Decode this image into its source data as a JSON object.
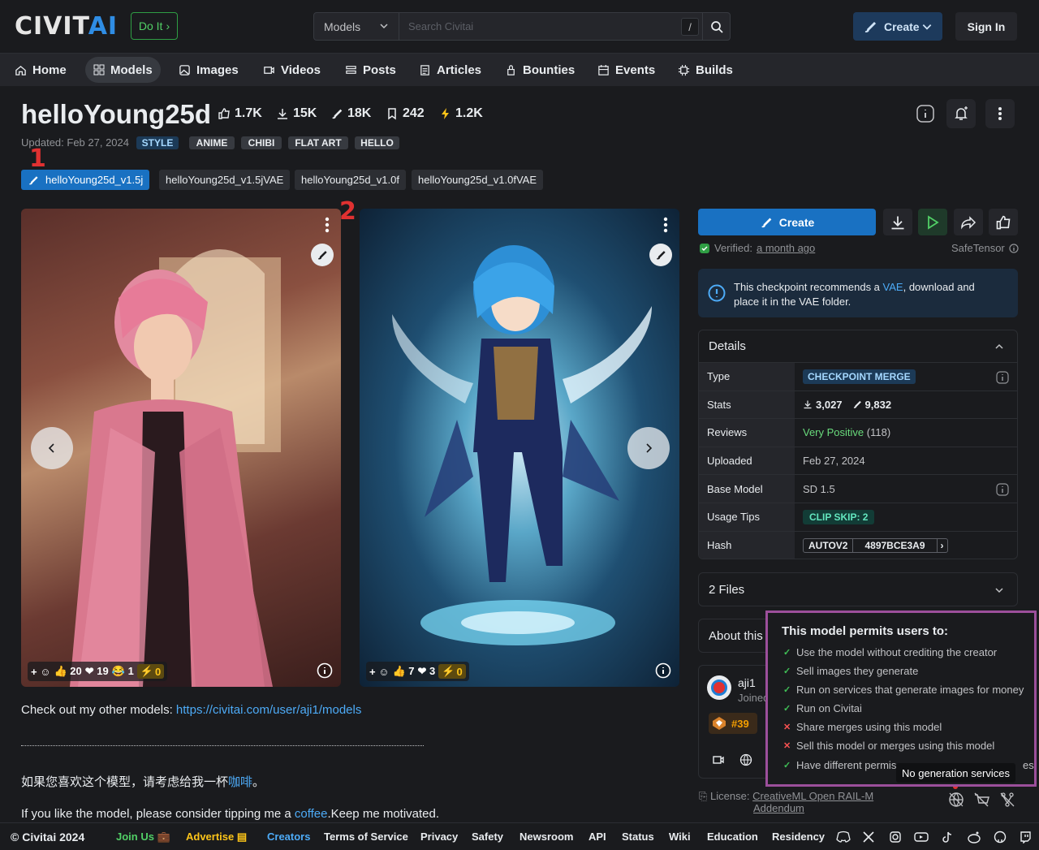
{
  "header": {
    "logo_main": "CIVIT",
    "logo_accent": "AI",
    "doit_label": "Do It",
    "search_type": "Models",
    "search_placeholder": "Search Civitai",
    "search_shortcut": "/",
    "create_label": "Create",
    "signin_label": "Sign In"
  },
  "nav": [
    {
      "label": "Home",
      "icon": "home-icon"
    },
    {
      "label": "Models",
      "icon": "models-icon"
    },
    {
      "label": "Images",
      "icon": "image-icon"
    },
    {
      "label": "Videos",
      "icon": "video-icon"
    },
    {
      "label": "Posts",
      "icon": "posts-icon"
    },
    {
      "label": "Articles",
      "icon": "article-icon"
    },
    {
      "label": "Bounties",
      "icon": "bounty-icon"
    },
    {
      "label": "Events",
      "icon": "calendar-icon"
    },
    {
      "label": "Builds",
      "icon": "cpu-icon"
    }
  ],
  "model": {
    "title": "helloYoung25d",
    "likes": "1.7K",
    "downloads": "15K",
    "generations": "18K",
    "collected": "242",
    "buzz": "1.2K",
    "updated": "Updated: Feb 27, 2024",
    "tags": [
      "STYLE",
      "ANIME",
      "CHIBI",
      "FLAT ART",
      "HELLO"
    ],
    "versions": [
      "helloYoung25d_v1.5j",
      "helloYoung25d_v1.5jVAE",
      "helloYoung25d_v1.0f",
      "helloYoung25d_v1.0fVAE"
    ],
    "annotation_1": "1",
    "annotation_2": "2"
  },
  "images": [
    {
      "likes": "20",
      "hearts": "19",
      "laughs": "1",
      "buzz": "0"
    },
    {
      "likes": "7",
      "hearts": "3",
      "buzz": "0"
    }
  ],
  "description": {
    "line1_text": "Check out my other models: ",
    "line1_link": "https://civitai.com/user/aji1/models",
    "line2_text": "如果您喜欢这个模型，请考虑给我一杯",
    "line2_link": "咖啡",
    "line2_end": "。",
    "line3_text": "If you like the model, please consider tipping me a ",
    "line3_link": "coffee",
    "line3_end": ".Keep me motivated."
  },
  "sidebar": {
    "create_label": "Create",
    "verified_label": "Verified:",
    "verified_time": "a month ago",
    "safetensor": "SafeTensor",
    "alert_pre": "This checkpoint recommends a ",
    "alert_link": "VAE",
    "alert_post": ", download and place it in the VAE folder.",
    "details_title": "Details",
    "type_key": "Type",
    "type_val": "CHECKPOINT MERGE",
    "stats_key": "Stats",
    "stats_downloads": "3,027",
    "stats_generations": "9,832",
    "reviews_key": "Reviews",
    "reviews_val": "Very Positive",
    "reviews_count": "(118)",
    "uploaded_key": "Uploaded",
    "uploaded_val": "Feb 27, 2024",
    "base_key": "Base Model",
    "base_val": "SD 1.5",
    "tips_key": "Usage Tips",
    "tips_val": "CLIP SKIP: 2",
    "hash_key": "Hash",
    "hash_type": "AUTOV2",
    "hash_val": "4897BCE3A9",
    "files_title": "2 Files",
    "about_title": "About this",
    "creator_name": "aji1",
    "creator_joined": "Joined",
    "creator_rank": "#39",
    "license_label": "License:",
    "license_link": "CreativeML Open RAIL-M",
    "license_link2": "Addendum"
  },
  "permissions": {
    "title": "This model permits users to:",
    "items": [
      {
        "text": "Use the model without crediting the creator",
        "allowed": true
      },
      {
        "text": "Sell images they generate",
        "allowed": true
      },
      {
        "text": "Run on services that generate images for money",
        "allowed": true
      },
      {
        "text": "Run on Civitai",
        "allowed": true
      },
      {
        "text": "Share merges using this model",
        "allowed": false
      },
      {
        "text": "Sell this model or merges using this model",
        "allowed": false
      },
      {
        "text": "Have different permis",
        "allowed": true
      }
    ],
    "tail": "es",
    "tooltip": "No generation services"
  },
  "footer": {
    "copyright": "© Civitai 2024",
    "links": [
      "Join Us",
      "Advertise",
      "Creators",
      "Terms of Service",
      "Privacy",
      "Safety",
      "Newsroom",
      "API",
      "Status",
      "Wiki",
      "Education",
      "Residency"
    ]
  },
  "colors": {
    "accent": "#1971c2",
    "success": "#40c057",
    "danger": "#fa5252",
    "popover_border": "#9c4f9b"
  }
}
